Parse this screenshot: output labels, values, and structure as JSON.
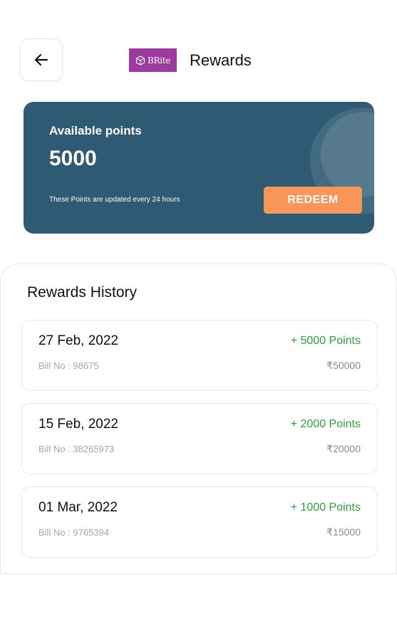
{
  "header": {
    "back_icon": "arrow-left-icon",
    "logo_text": "BRite",
    "logo_icon": "cube-icon",
    "title": "Rewards"
  },
  "points_card": {
    "label": "Available points",
    "value": "5000",
    "note": "These Points are updated every 24 hours",
    "redeem_label": "REDEEM"
  },
  "history": {
    "title": "Rewards History",
    "items": [
      {
        "date": "27 Feb, 2022",
        "points": "+ 5000 Points",
        "bill": "Bill No : 98675",
        "amount": "₹50000"
      },
      {
        "date": "15 Feb, 2022",
        "points": "+ 2000 Points",
        "bill": "Bill No : 38265973",
        "amount": "₹20000"
      },
      {
        "date": "01 Mar, 2022",
        "points": "+ 1000 Points",
        "bill": "Bill No : 9765394",
        "amount": "₹15000"
      }
    ]
  },
  "colors": {
    "card_bg": "#2f5a74",
    "redeem_bg": "#f89559",
    "points_green": "#2aa33a",
    "logo_purple": "#9c3aa0"
  }
}
